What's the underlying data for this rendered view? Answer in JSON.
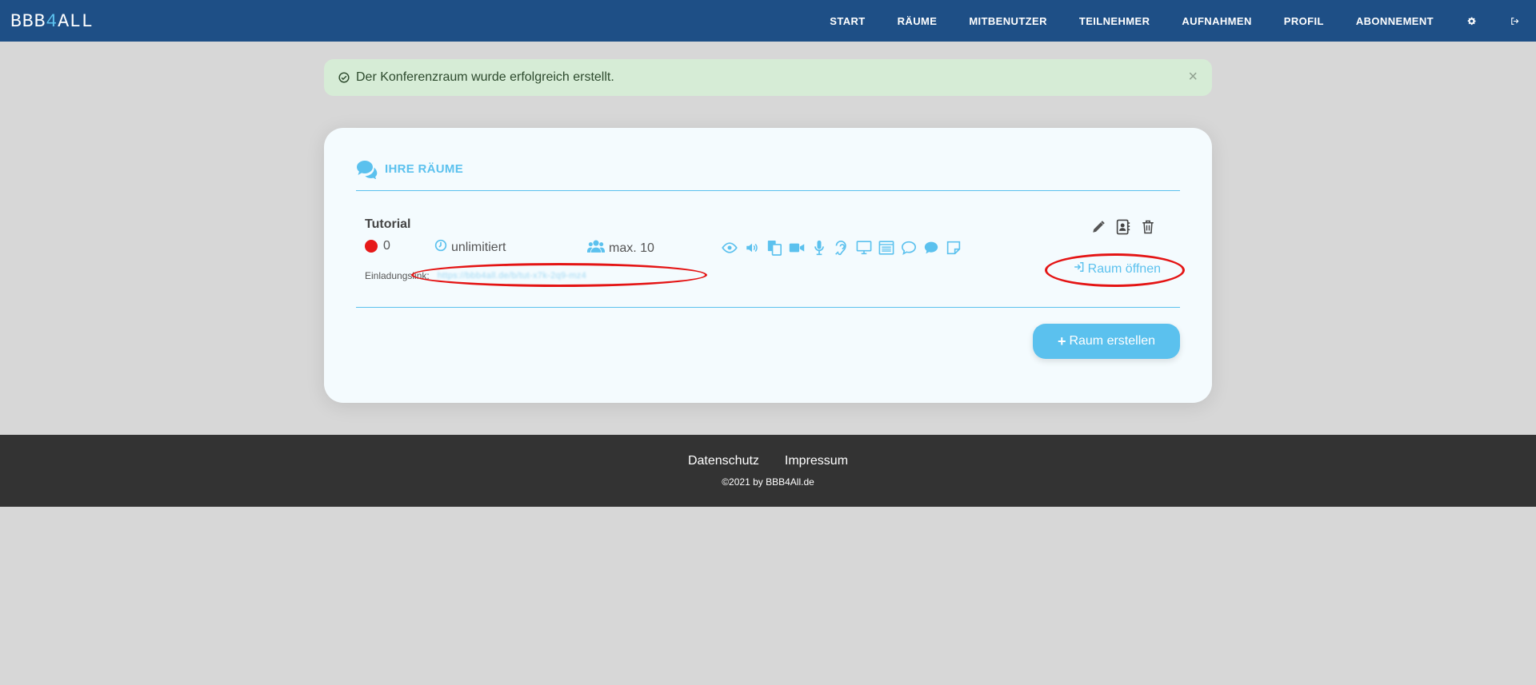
{
  "app": {
    "logo_prefix": "BBB",
    "logo_mid": "4",
    "logo_suffix": "ALL"
  },
  "nav": {
    "items": [
      "START",
      "RÄUME",
      "MITBENUTZER",
      "TEILNEHMER",
      "AUFNAHMEN",
      "PROFIL",
      "ABONNEMENT"
    ],
    "icons": [
      "gear-icon",
      "logout-icon"
    ]
  },
  "alert": {
    "message": "Der Konferenzraum wurde erfolgreich erstellt.",
    "close": "×"
  },
  "rooms": {
    "title": "IHRE RÄUME",
    "items": [
      {
        "name": "Tutorial",
        "participants": "0",
        "duration": "unlimitiert",
        "max": "max. 10",
        "invite_label": "Einladungslink:",
        "invite_link": "https://bbb4all.de/b/tut-x7k-2q9-mz4",
        "open_label": "Raum öffnen",
        "features": [
          "eye-icon",
          "speaker-icon",
          "documents-icon",
          "video-icon",
          "microphone-icon",
          "hearing-icon",
          "screen-icon",
          "layout-icon",
          "chat-outline-icon",
          "chat-filled-icon",
          "note-icon"
        ],
        "actions": [
          "edit-icon",
          "contacts-icon",
          "trash-icon"
        ]
      }
    ],
    "create_label": "Raum erstellen",
    "create_plus": "+"
  },
  "footer": {
    "links": [
      "Datenschutz",
      "Impressum"
    ],
    "copyright": "©2021 by BBB4All.de"
  },
  "colors": {
    "navbar": "#1e4f86",
    "accent": "#5bc1ee",
    "alert_bg": "#d6ecd6",
    "status_offline": "#e61919",
    "annotation": "#e41414",
    "footer": "#333333"
  }
}
